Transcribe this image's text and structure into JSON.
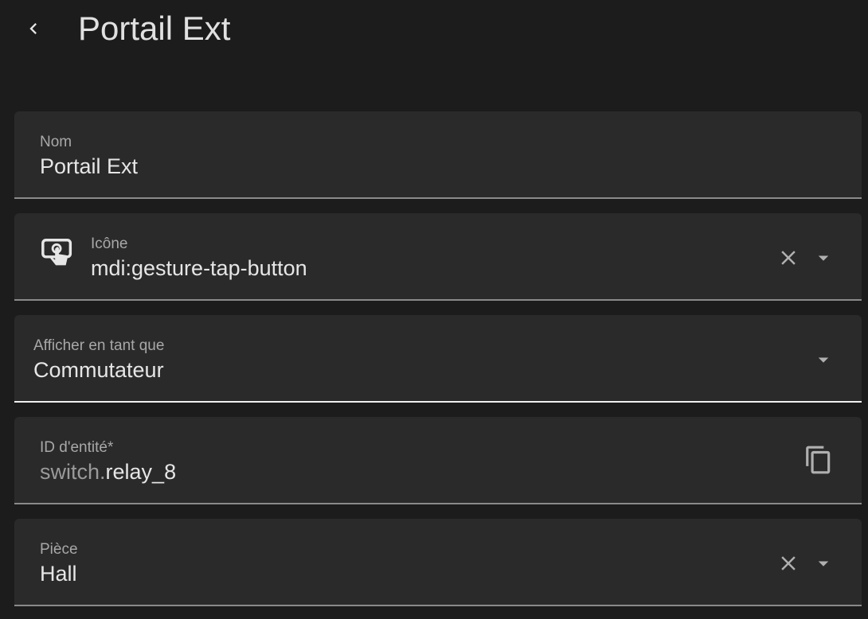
{
  "header": {
    "title": "Portail Ext",
    "back_icon": "chevron-left-icon"
  },
  "fields": {
    "name": {
      "label": "Nom",
      "value": "Portail Ext"
    },
    "icon": {
      "label": "Icône",
      "value": "mdi:gesture-tap-button",
      "leading_icon": "gesture-tap-button-icon",
      "clear_icon": "close-icon",
      "dropdown_icon": "menu-down-icon"
    },
    "display_as": {
      "label": "Afficher en tant que",
      "value": "Commutateur",
      "dropdown_icon": "menu-down-icon"
    },
    "entity_id": {
      "label": "ID d'entité*",
      "prefix": "switch.",
      "value": "relay_8",
      "copy_icon": "content-copy-icon"
    },
    "area": {
      "label": "Pièce",
      "value": "Hall",
      "clear_icon": "close-icon",
      "dropdown_icon": "menu-down-icon"
    }
  },
  "colors": {
    "background": "#1c1c1c",
    "field_background": "#2a2a2a",
    "text_primary": "#e6e6e6",
    "text_secondary": "#a8a8a8"
  }
}
